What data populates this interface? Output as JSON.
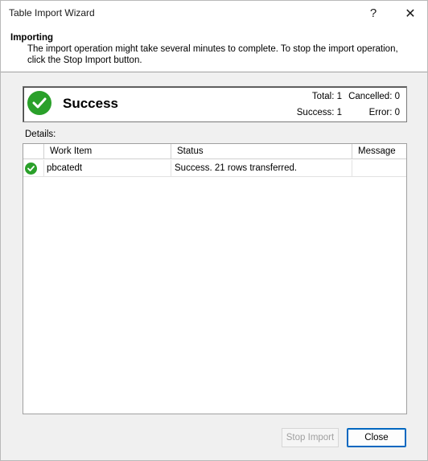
{
  "window": {
    "title": "Table Import Wizard",
    "help_label": "?",
    "close_glyph": "✕"
  },
  "header": {
    "title": "Importing",
    "description_line1": "The import operation might take several minutes to complete. To stop the import operation,",
    "description_line2": "click the Stop Import button."
  },
  "status": {
    "icon": "success-check-icon",
    "label": "Success",
    "total": "Total: 1",
    "cancelled": "Cancelled: 0",
    "success": "Success: 1",
    "error": "Error: 0",
    "accent_color": "#2aa02a"
  },
  "details": {
    "label": "Details:",
    "columns": [
      "Work Item",
      "Status",
      "Message"
    ],
    "rows": [
      {
        "icon": "success-check-icon",
        "work_item": "pbcatedt",
        "status": "Success. 21 rows transferred.",
        "message": ""
      }
    ]
  },
  "buttons": {
    "stop_import": "Stop Import",
    "close": "Close"
  }
}
